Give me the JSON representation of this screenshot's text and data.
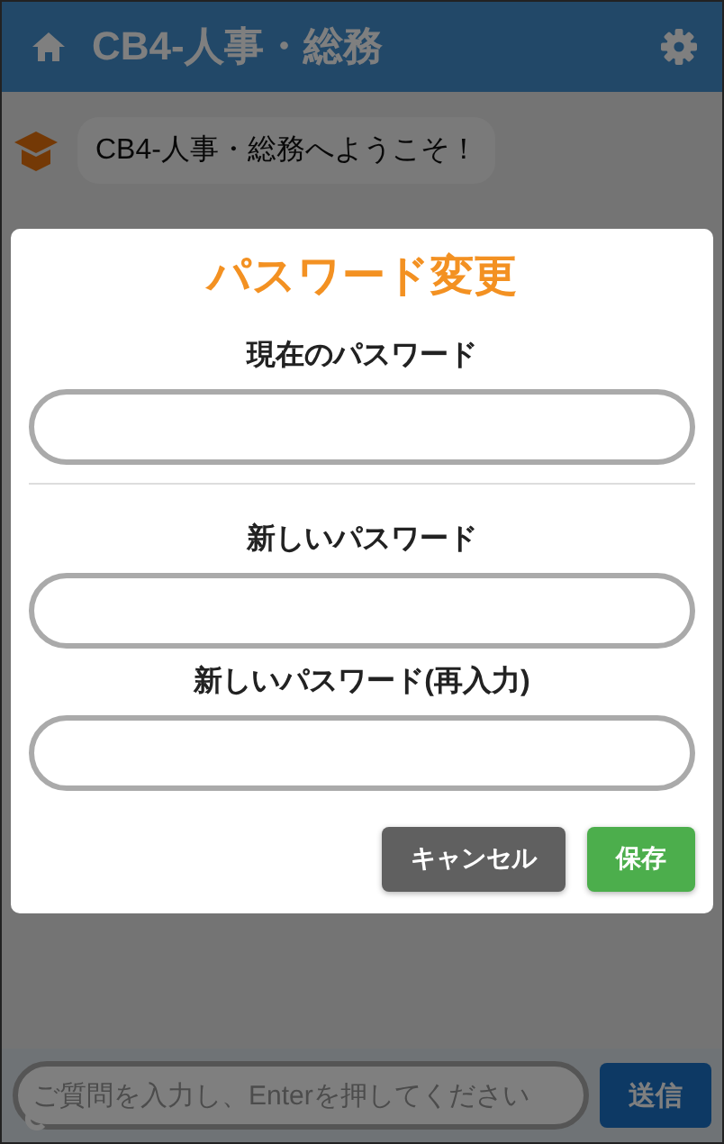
{
  "header": {
    "title": "CB4-人事・総務"
  },
  "messages": [
    {
      "text": "CB4-人事・総務へようこそ！"
    }
  ],
  "dialog": {
    "title": "パスワード変更",
    "fields": [
      {
        "label": "現在のパスワード"
      },
      {
        "label": "新しいパスワード"
      },
      {
        "label": "新しいパスワード(再入力)"
      }
    ],
    "buttons": [
      {
        "label": "キャンセル",
        "kind": "cancel"
      },
      {
        "label": "保存",
        "kind": "save"
      }
    ]
  },
  "composer": {
    "placeholder": "ご質問を入力し、Enterを押してください",
    "send": "送信"
  }
}
